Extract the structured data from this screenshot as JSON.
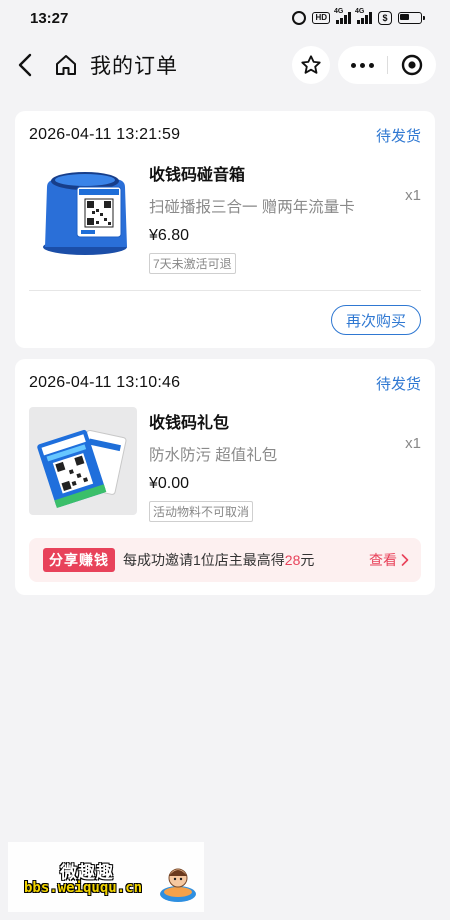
{
  "status_bar": {
    "time": "13:27",
    "hd_label": "HD",
    "sim1_label": "4G",
    "sim2_label": "4G",
    "icons": [
      "alarm-icon",
      "hd-icon",
      "signal-icon",
      "signal-icon",
      "dollar-shield-icon",
      "battery-icon"
    ]
  },
  "nav": {
    "title": "我的订单",
    "icons": [
      "back-arrow-icon",
      "home-icon",
      "star-icon",
      "more-dots-icon",
      "close-circle-icon"
    ]
  },
  "orders": [
    {
      "time": "2026-04-11 13:21:59",
      "status": "待发货",
      "product_name": "收钱码碰音箱",
      "product_desc": "扫碰播报三合一  赠两年流量卡",
      "quantity": "x1",
      "price": "¥6.80",
      "tag": "7天未激活可退",
      "action_label": "再次购买",
      "accent": "#2f78d2"
    },
    {
      "time": "2026-04-11 13:10:46",
      "status": "待发货",
      "product_name": "收钱码礼包",
      "product_desc": "防水防污  超值礼包",
      "quantity": "x1",
      "price": "¥0.00",
      "tag": "活动物料不可取消",
      "share": {
        "badge": "分享赚钱",
        "text_prefix": "每成功邀请1位店主最高得",
        "amount": "28",
        "text_suffix": "元",
        "link": "查看",
        "color": "#e8425a"
      }
    }
  ],
  "watermark": {
    "line1": "微趣趣",
    "line2": "bbs.weiququ.cn"
  }
}
